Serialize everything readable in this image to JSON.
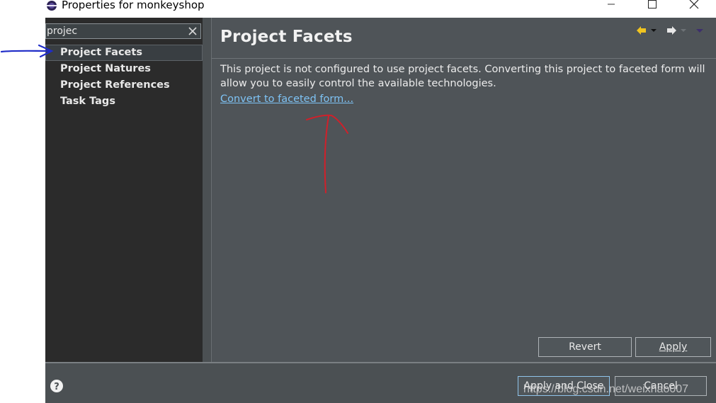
{
  "window": {
    "title": "Properties for monkeyshop"
  },
  "sidebar": {
    "filter_value": "projec",
    "items": [
      {
        "label": "Project Facets"
      },
      {
        "label": "Project Natures"
      },
      {
        "label": "Project References"
      },
      {
        "label": "Task Tags"
      }
    ]
  },
  "content": {
    "title": "Project Facets",
    "description": "This project is not configured to use project facets. Converting this project to faceted form will allow you to easily control the available technologies.",
    "link": "Convert to faceted form..."
  },
  "buttons": {
    "revert": "Revert",
    "apply": "Apply",
    "apply_close": "Apply and Close",
    "cancel": "Cancel"
  },
  "watermark": "https://blog.csdn.net/weixhao007",
  "colors": {
    "annotation_blue": "#1f2cc8",
    "annotation_red": "#d0202a",
    "link": "#7ec3f5",
    "nav_arrow": "#f0c420"
  },
  "icons": [
    "app-icon",
    "minimize-icon",
    "maximize-icon",
    "close-icon",
    "clear-filter-icon",
    "back-arrow-icon",
    "forward-arrow-icon",
    "dropdown-icon",
    "menu-icon",
    "help-icon"
  ]
}
